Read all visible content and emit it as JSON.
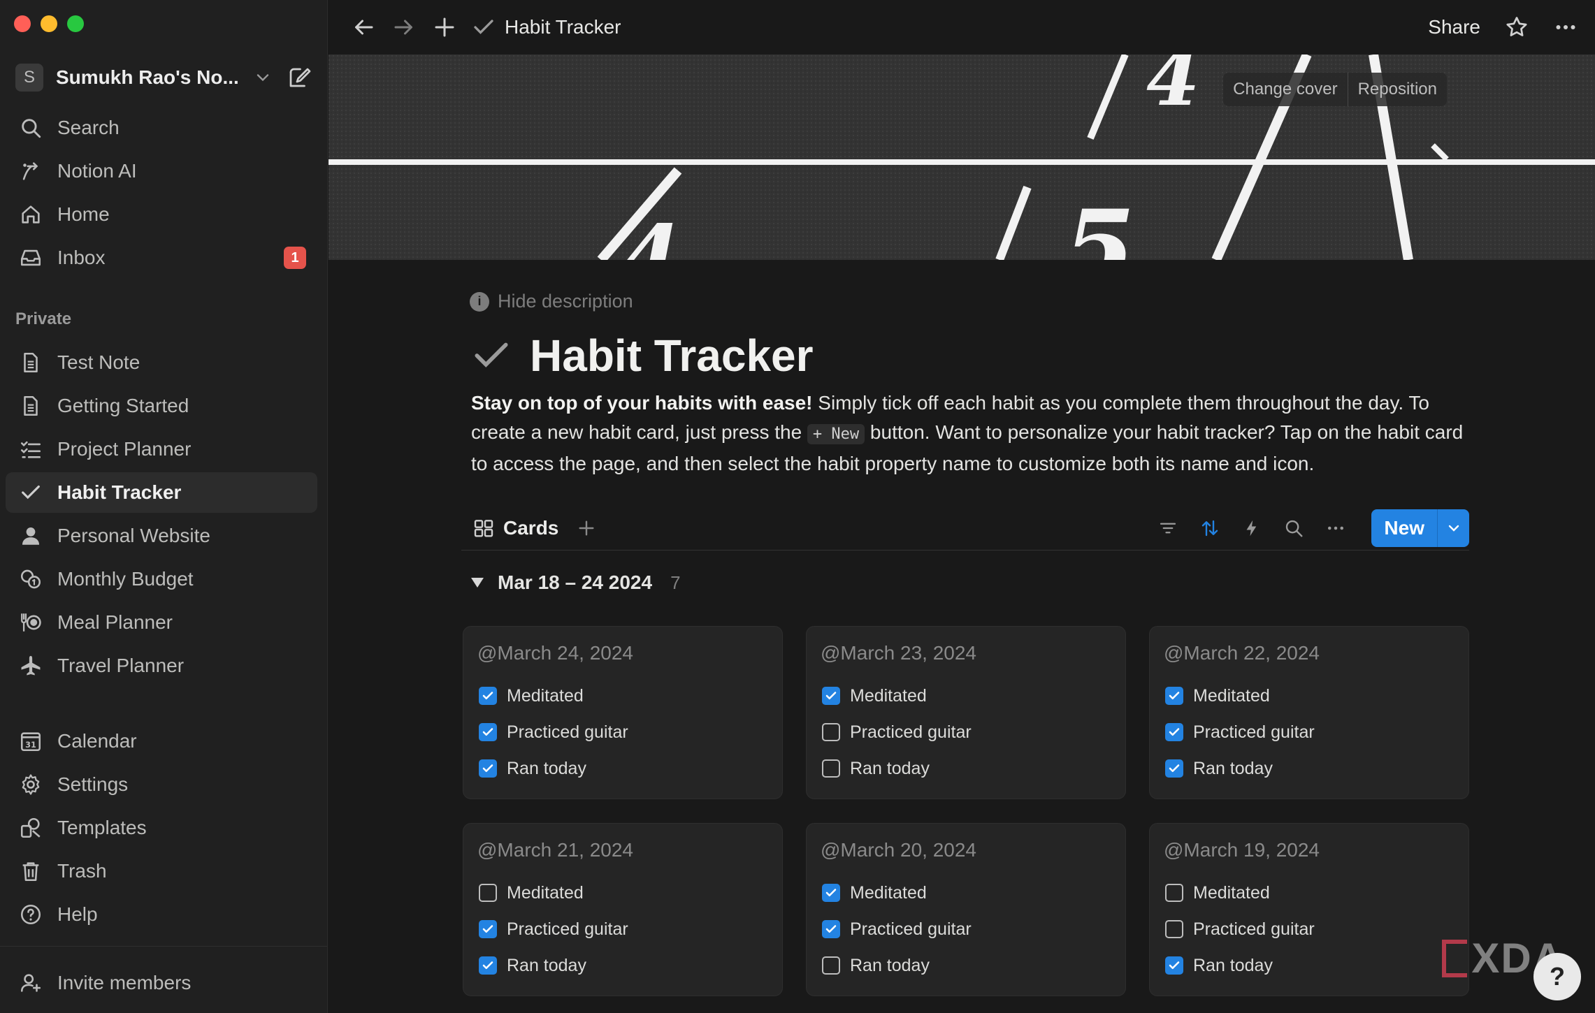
{
  "window": {
    "title": "Habit Tracker"
  },
  "workspace": {
    "initial": "S",
    "name": "Sumukh Rao's No..."
  },
  "nav_top": [
    {
      "label": "Search",
      "icon": "search-icon"
    },
    {
      "label": "Notion AI",
      "icon": "notion-ai-icon"
    },
    {
      "label": "Home",
      "icon": "home-icon"
    },
    {
      "label": "Inbox",
      "icon": "inbox-icon",
      "badge": "1"
    }
  ],
  "private_section": {
    "label": "Private",
    "pages": [
      {
        "label": "Test Note",
        "icon": "document-icon"
      },
      {
        "label": "Getting Started",
        "icon": "document-icon"
      },
      {
        "label": "Project Planner",
        "icon": "checklist-icon"
      },
      {
        "label": "Habit Tracker",
        "icon": "check-icon",
        "active": true
      },
      {
        "label": "Personal Website",
        "icon": "person-icon"
      },
      {
        "label": "Monthly Budget",
        "icon": "coins-icon"
      },
      {
        "label": "Meal Planner",
        "icon": "cutlery-icon"
      },
      {
        "label": "Travel Planner",
        "icon": "airplane-icon"
      }
    ]
  },
  "nav_bottom": [
    {
      "label": "Calendar",
      "icon": "calendar-icon"
    },
    {
      "label": "Settings",
      "icon": "gear-icon"
    },
    {
      "label": "Templates",
      "icon": "templates-icon"
    },
    {
      "label": "Trash",
      "icon": "trash-icon"
    },
    {
      "label": "Help",
      "icon": "help-icon"
    }
  ],
  "invite": {
    "label": "Invite members",
    "icon": "invite-icon"
  },
  "calendar_icon_day": "31",
  "topbar": {
    "page_title": "Habit Tracker",
    "share_label": "Share"
  },
  "cover": {
    "change_label": "Change cover",
    "reposition_label": "Reposition"
  },
  "page": {
    "hide_description": "Hide description",
    "title": "Habit Tracker",
    "description_bold": "Stay on top of your habits with ease!",
    "description_1": " Simply tick off each habit as you complete them throughout the day. To create a new habit card, just press the ",
    "description_code": "+ New",
    "description_2": " button. Want to personalize your habit tracker? Tap on the habit card to access the page, and then select the habit property name to customize both its name and icon."
  },
  "view": {
    "tab_label": "Cards",
    "new_label": "New"
  },
  "group": {
    "title": "Mar 18 – 24 2024",
    "count": "7"
  },
  "cards": [
    {
      "title": "@March 24, 2024",
      "habits": [
        {
          "label": "Meditated",
          "checked": true
        },
        {
          "label": "Practiced guitar",
          "checked": true
        },
        {
          "label": "Ran today",
          "checked": true
        }
      ]
    },
    {
      "title": "@March 23, 2024",
      "habits": [
        {
          "label": "Meditated",
          "checked": true
        },
        {
          "label": "Practiced guitar",
          "checked": false
        },
        {
          "label": "Ran today",
          "checked": false
        }
      ]
    },
    {
      "title": "@March 22, 2024",
      "habits": [
        {
          "label": "Meditated",
          "checked": true
        },
        {
          "label": "Practiced guitar",
          "checked": true
        },
        {
          "label": "Ran today",
          "checked": true
        }
      ]
    },
    {
      "title": "@March 21, 2024",
      "habits": [
        {
          "label": "Meditated",
          "checked": false
        },
        {
          "label": "Practiced guitar",
          "checked": true
        },
        {
          "label": "Ran today",
          "checked": true
        }
      ]
    },
    {
      "title": "@March 20, 2024",
      "habits": [
        {
          "label": "Meditated",
          "checked": true
        },
        {
          "label": "Practiced guitar",
          "checked": true
        },
        {
          "label": "Ran today",
          "checked": false
        }
      ]
    },
    {
      "title": "@March 19, 2024",
      "habits": [
        {
          "label": "Meditated",
          "checked": false
        },
        {
          "label": "Practiced guitar",
          "checked": false
        },
        {
          "label": "Ran today",
          "checked": true
        }
      ]
    }
  ],
  "watermark": "XDA",
  "help_fab": "?",
  "colors": {
    "accent": "#2383e2",
    "badge": "#e5534b",
    "background": "#191919",
    "sidebar": "#202020"
  }
}
